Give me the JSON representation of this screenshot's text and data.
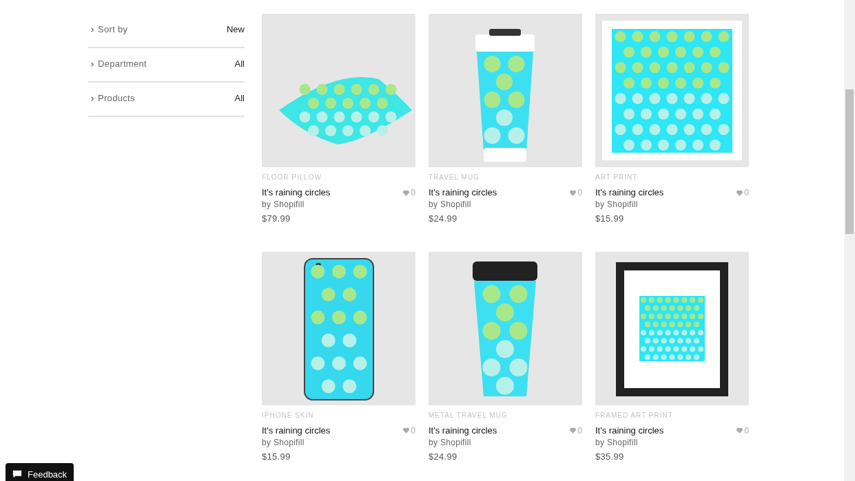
{
  "filters": [
    {
      "label": "Sort by",
      "value": "New"
    },
    {
      "label": "Department",
      "value": "All"
    },
    {
      "label": "Products",
      "value": "All"
    }
  ],
  "products": [
    {
      "kind": "pillow",
      "category": "FLOOR PILLOW",
      "title": "It's raining circles",
      "by": "by Shopifill",
      "likes": "0",
      "price": "$79.99"
    },
    {
      "kind": "mug",
      "category": "TRAVEL MUG",
      "title": "It's raining circles",
      "by": "by Shopifill",
      "likes": "0",
      "price": "$24.99"
    },
    {
      "kind": "print",
      "category": "ART PRINT",
      "title": "It's raining circles",
      "by": "by Shopifill",
      "likes": "0",
      "price": "$15.99"
    },
    {
      "kind": "phone",
      "category": "IPHONE SKIN",
      "title": "It's raining circles",
      "by": "by Shopifill",
      "likes": "0",
      "price": "$15.99"
    },
    {
      "kind": "metal_mug",
      "category": "METAL TRAVEL MUG",
      "title": "It's raining circles",
      "by": "by Shopifill",
      "likes": "0",
      "price": "$24.99"
    },
    {
      "kind": "framed",
      "category": "FRAMED ART PRINT",
      "title": "It's raining circles",
      "by": "by Shopifill",
      "likes": "0",
      "price": "$35.99"
    }
  ],
  "feedback": "Feedback"
}
